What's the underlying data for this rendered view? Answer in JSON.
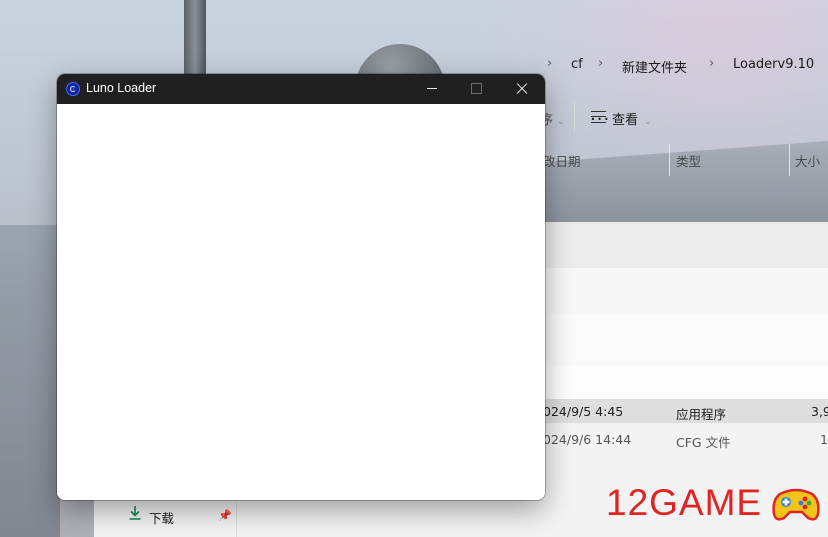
{
  "explorer": {
    "breadcrumbs": [
      "cf",
      "新建文件夹",
      "Loaderv9.10"
    ],
    "toolbar": {
      "sort_partial": "序",
      "view_label": "查看",
      "more_label": "..."
    },
    "columns": {
      "date_partial": "改日期",
      "type": "类型",
      "size_partial": "大小"
    },
    "rows": [
      {
        "date": "024/9/5 4:45",
        "type": "应用程序",
        "size": "3,9"
      },
      {
        "date": "024/9/6 14:44",
        "type": "CFG 文件",
        "size": "1"
      }
    ],
    "nav": {
      "downloads_label": "下载"
    }
  },
  "loader": {
    "title": "Luno Loader"
  },
  "watermark": {
    "text": "12GAME"
  },
  "colors": {
    "watermark_red": "#e02424",
    "loader_titlebar": "#202020",
    "selected_row": "#dedede"
  }
}
